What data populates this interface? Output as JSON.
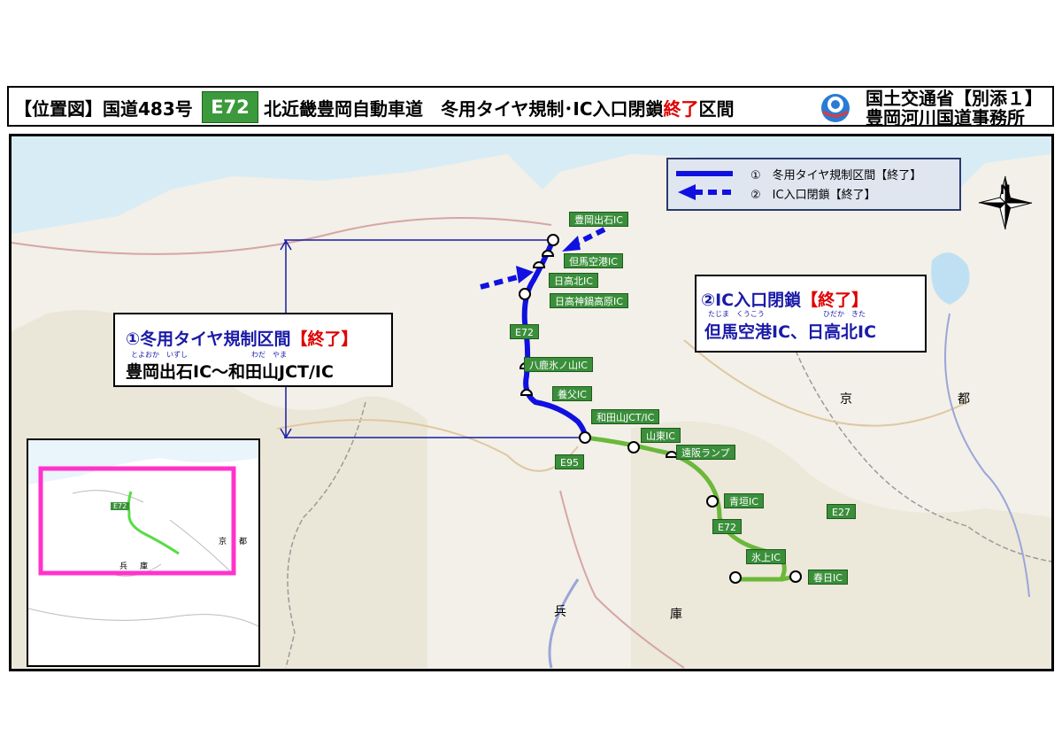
{
  "header": {
    "location_label": "【位置図】",
    "route_label": "国道483号",
    "route_badge": "E72",
    "title_prefix": "北近畿豊岡自動車道　冬用タイヤ規制･IC入口閉鎖",
    "title_emphasis": "終了",
    "title_suffix": "区間",
    "ministry_line1": "国土交通省【別添１】",
    "ministry_line2": "豊岡河川国道事務所"
  },
  "legend": {
    "item1": "①　冬用タイヤ規制区間【終了】",
    "item2": "②　IC入口閉鎖【終了】"
  },
  "compass": {
    "label": "N"
  },
  "info1": {
    "title_main": "①冬用タイヤ規制区間",
    "title_emphasis": "【終了】",
    "ruby1": "とよおか　いずし",
    "ruby2": "わだ　やま",
    "route": "豊岡出石IC～和田山JCT/IC"
  },
  "info2": {
    "title_main": "②IC入口閉鎖",
    "title_emphasis": "【終了】",
    "ruby1": "たじま　くうこう",
    "ruby2": "ひだか　きた",
    "ics": "但馬空港IC、日高北IC"
  },
  "ic_labels": {
    "toyooka_izushi": "豊岡出石IC",
    "tajima_airport": "但馬空港IC",
    "hidaka_kita": "日高北IC",
    "hidaka_kannabe": "日高神鍋高原IC",
    "e72_a": "E72",
    "yoka_hachi": "八鹿氷ノ山IC",
    "yabu": "養父IC",
    "wadayama": "和田山JCT/IC",
    "santo": "山東IC",
    "tohsaka": "遠阪ランプ",
    "e95": "E95",
    "aogaki": "青垣IC",
    "e27": "E27",
    "e72_b": "E72",
    "hikami": "氷上IC",
    "kasuga": "春日IC"
  },
  "map_text": {
    "kyo": "京",
    "to": "都",
    "hyo": "兵",
    "ko": "庫"
  },
  "inset": {
    "e72": "E72",
    "kyo": "京",
    "to": "都",
    "hyo": "兵",
    "ko": "庫"
  },
  "colors": {
    "blue_route": "#1010e0",
    "green_route": "#6bb83a",
    "label_green": "#3b8f3b",
    "emphasis_red": "#e00000",
    "inset_frame": "#ff33cc"
  }
}
